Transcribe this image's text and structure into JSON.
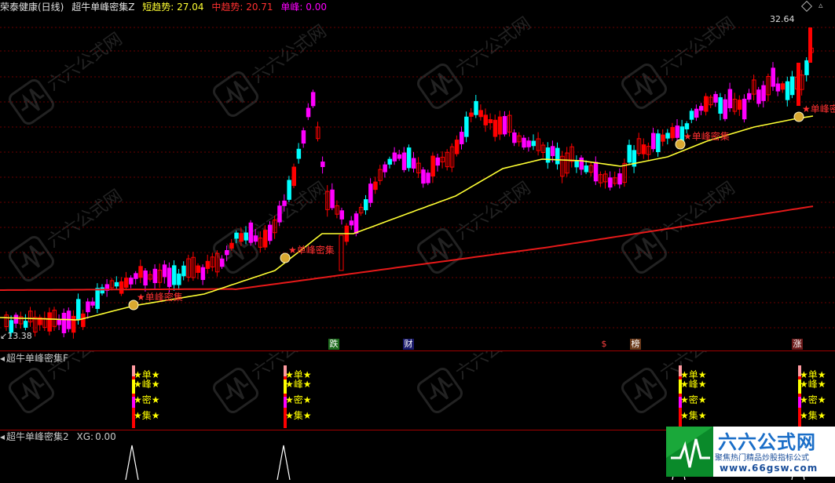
{
  "main_panel": {
    "title": "荣泰健康(日线)",
    "indicator": "超牛单峰密集Z",
    "short_trend_label": "短趋势:",
    "short_trend_value": "27.04",
    "mid_trend_label": "中趋势:",
    "mid_trend_value": "20.71",
    "peak_label": "单峰:",
    "peak_value": "0.00",
    "price_high": "32.64",
    "price_low": "13.38",
    "signal_label": "单峰密集",
    "event_tags": [
      "跌",
      "财",
      "$",
      "榜",
      "涨"
    ]
  },
  "panel_f": {
    "title": "超牛单峰密集F",
    "chars": [
      "单",
      "峰",
      "密",
      "集"
    ]
  },
  "panel_2": {
    "title": "超牛单峰密集2",
    "xg_label": "XG:",
    "xg_value": "0.00"
  },
  "logo": {
    "brand": "六六公式网",
    "slogan": "聚焦热门精品炒股指标公式",
    "url": "www.66gsw.com"
  },
  "colors": {
    "up": "#ff0000",
    "down": "#00ffff",
    "signal": "#ff00ff",
    "short_ma": "#ffff33",
    "mid_ma": "#e61919",
    "star": "#ffff00"
  }
}
